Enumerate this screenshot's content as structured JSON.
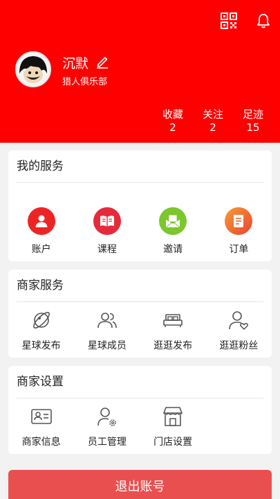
{
  "profile": {
    "name": "沉默",
    "club": "猎人俱乐部"
  },
  "stats": [
    {
      "label": "收藏",
      "value": "2"
    },
    {
      "label": "关注",
      "value": "2"
    },
    {
      "label": "足迹",
      "value": "15"
    }
  ],
  "my_services": {
    "title": "我的服务",
    "items": [
      {
        "label": "账户",
        "icon": "user-icon",
        "color": "#ee2424"
      },
      {
        "label": "课程",
        "icon": "book-icon",
        "color": "#e52b3b"
      },
      {
        "label": "邀请",
        "icon": "envelope-icon",
        "color": "#7cc72d"
      },
      {
        "label": "订单",
        "icon": "order-icon",
        "color": "#f37021"
      }
    ]
  },
  "merchant_services": {
    "title": "商家服务",
    "items": [
      {
        "label": "星球发布",
        "icon": "planet-icon"
      },
      {
        "label": "星球成员",
        "icon": "members-icon"
      },
      {
        "label": "逛逛发布",
        "icon": "bed-icon"
      },
      {
        "label": "逛逛粉丝",
        "icon": "fan-icon"
      }
    ]
  },
  "merchant_settings": {
    "title": "商家设置",
    "items": [
      {
        "label": "商家信息",
        "icon": "id-card-icon"
      },
      {
        "label": "员工管理",
        "icon": "staff-settings-icon"
      },
      {
        "label": "门店设置",
        "icon": "store-icon"
      }
    ]
  },
  "logout_label": "退出账号"
}
